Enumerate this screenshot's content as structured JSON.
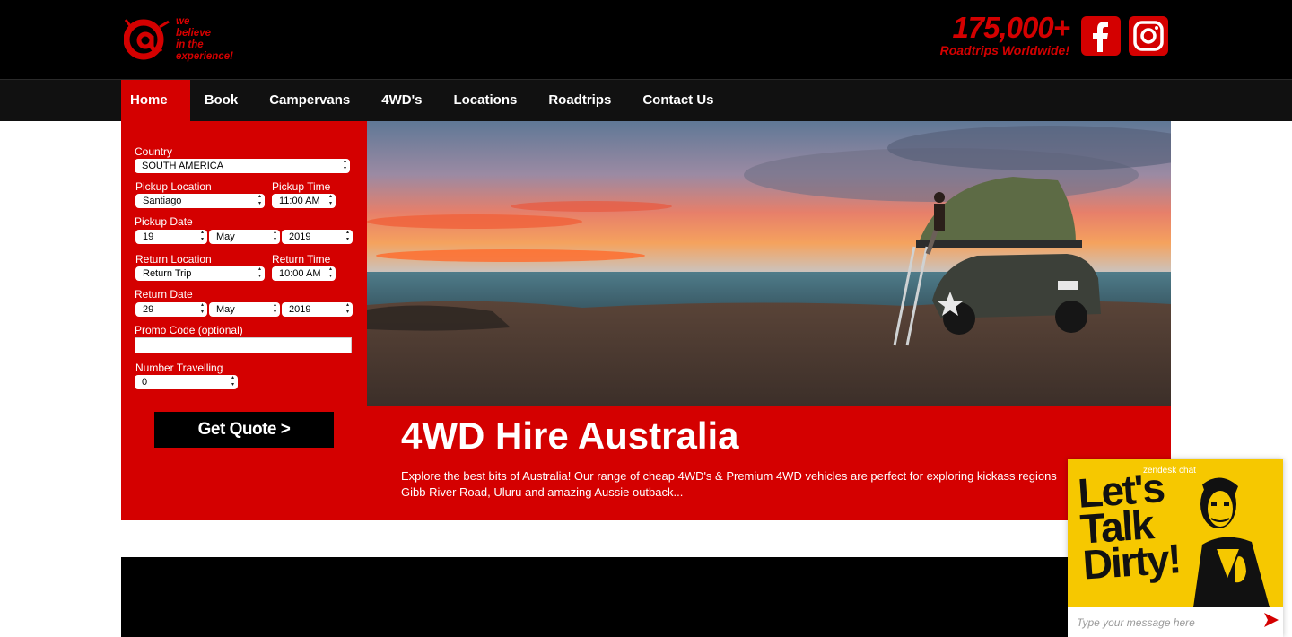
{
  "header": {
    "logo_tagline": "we\nbelieve\nin the\nexperience!",
    "counter_value": "175,000+",
    "counter_label": "Roadtrips Worldwide!",
    "social": [
      "facebook-icon",
      "instagram-icon"
    ],
    "brand_color": "#d40000"
  },
  "nav": {
    "items": [
      "Home",
      "Book",
      "Campervans",
      "4WD's",
      "Locations",
      "Roadtrips",
      "Contact Us"
    ],
    "active": "Home"
  },
  "booking": {
    "country_label": "Country",
    "country_value": "SOUTH AMERICA",
    "pickup_location_label": "Pickup Location",
    "pickup_location_value": "Santiago",
    "pickup_time_label": "Pickup Time",
    "pickup_time_value": "11:00 AM",
    "pickup_date_label": "Pickup Date",
    "pickup_day": "19",
    "pickup_month": "May",
    "pickup_year": "2019",
    "return_location_label": "Return Location",
    "return_location_value": "Return Trip",
    "return_time_label": "Return Time",
    "return_time_value": "10:00 AM",
    "return_date_label": "Return Date",
    "return_day": "29",
    "return_month": "May",
    "return_year": "2019",
    "promo_label": "Promo Code (optional)",
    "promo_value": "",
    "travellers_label": "Number Travelling",
    "travellers_value": "0",
    "quote_button": "Get Quote >"
  },
  "hero": {
    "title": "4WD Hire Australia",
    "description": "Explore the best bits of Australia! Our range of cheap 4WD's & Premium 4WD vehicles are perfect for exploring kickass regions Gibb River Road, Uluru and amazing Aussie outback..."
  },
  "chat": {
    "brand": "zendesk chat",
    "headline": "Let's\nTalk\nDirty!",
    "input_placeholder": "Type your message here"
  }
}
